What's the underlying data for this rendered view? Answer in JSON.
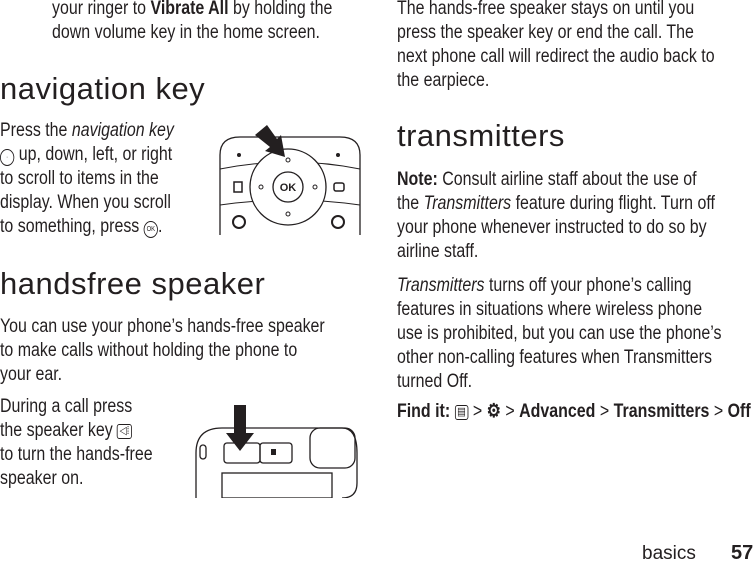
{
  "left": {
    "intro": {
      "l1a": "your ringer to ",
      "l1b": "Vibrate All",
      "l1c": " by holding the",
      "l2": "down volume key in the home screen."
    },
    "nav": {
      "heading": "navigation key",
      "l1a": "Press the ",
      "l1b": "navigation key",
      "l2": " up, down, left, or right",
      "l3": "to scroll to items in the",
      "l4": "display. When you scroll",
      "l5a": "to something, press ",
      "l5b": "."
    },
    "nav_figure": {
      "ok_label": "OK"
    },
    "hf": {
      "heading": "handsfree speaker",
      "p1": [
        "You can use your phone’s hands-free speaker",
        "to make calls without holding the phone to",
        "your ear."
      ],
      "p2": [
        "During a call press",
        "the speaker key",
        "to turn the hands-free",
        "speaker on."
      ]
    }
  },
  "right": {
    "intro": [
      "The hands-free speaker stays on until you",
      "press the speaker key or end the call. The",
      "next phone call will redirect the audio back to",
      "the earpiece."
    ],
    "tx": {
      "heading": "transmitters",
      "note_label": "Note:",
      "n1": " Consult airline staff about the use of",
      "n2a": "the ",
      "n2b": "Transmitters",
      "n2c": " feature during flight. Turn off",
      "n3": "your phone whenever instructed to do so by",
      "n4": "airline staff.",
      "p1a": "Transmitters",
      "p1b": " turns off your phone’s calling",
      "p": [
        "features in situations where wireless phone",
        "use is prohibited, but you can use the phone’s",
        "other non-calling features when Transmitters",
        "turned Off."
      ],
      "find_label": "Find it:",
      "sep": ">",
      "path": [
        "Advanced",
        "Transmitters",
        "Off"
      ]
    }
  },
  "footer": {
    "section": "basics",
    "page": "57"
  }
}
